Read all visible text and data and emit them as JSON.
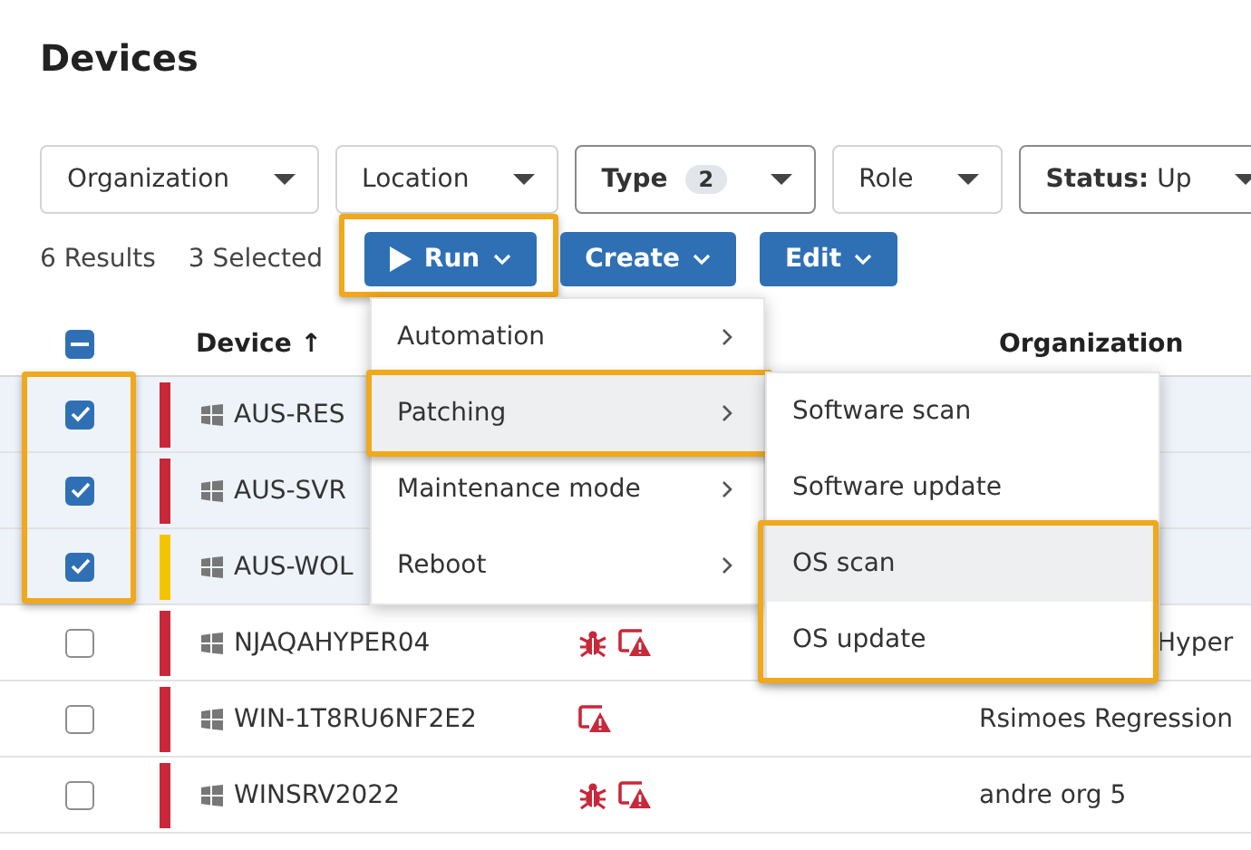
{
  "page": {
    "title": "Devices"
  },
  "filters": [
    {
      "label": "Organization",
      "active": false
    },
    {
      "label": "Location",
      "active": false
    },
    {
      "label": "Type",
      "badge": "2",
      "active": true
    },
    {
      "label": "Role",
      "active": false
    },
    {
      "label": "**Status:** Up",
      "active": true
    }
  ],
  "toolbar": {
    "results": "6 Results",
    "selected": "3 Selected",
    "actions": [
      {
        "label": "Run",
        "kind": "play",
        "highlighted": true
      },
      {
        "label": "Create",
        "kind": "plain",
        "highlighted": false
      },
      {
        "label": "Edit",
        "kind": "plain",
        "highlighted": false
      }
    ]
  },
  "table": {
    "select_all_partial": true,
    "checkbox_highlight": true,
    "columns": [
      {
        "label": "Device",
        "sort": "↑"
      },
      {
        "label": "Organization"
      }
    ],
    "rows": [
      {
        "selected": true,
        "color": "#c8283a",
        "device": "AUS-RES",
        "bug": false,
        "warning": false
      },
      {
        "selected": true,
        "color": "#c8283a",
        "device": "AUS-SVR",
        "bug": false,
        "warning": false
      },
      {
        "selected": true,
        "color": "#f5c400",
        "device": "AUS-WOL",
        "bug": false,
        "warning": false
      },
      {
        "selected": false,
        "color": "#c8283a",
        "device": "NJAQAHYPER04",
        "bug": true,
        "warning": true,
        "organization": "Hyper",
        "organization_clipped_left": true
      },
      {
        "selected": false,
        "color": "#c8283a",
        "device": "WIN-1T8RU6NF2E2",
        "bug": false,
        "warning": true,
        "organization": "Rsimoes Regression"
      },
      {
        "selected": false,
        "color": "#c8283a",
        "device": "WINSRV2022",
        "bug": true,
        "warning": true,
        "organization": "andre org 5"
      }
    ]
  },
  "menu": {
    "items": [
      {
        "label": "Automation",
        "selected": false,
        "highlighted": false
      },
      {
        "label": "Patching",
        "selected": true,
        "highlighted": true
      },
      {
        "label": "Maintenance mode",
        "selected": false,
        "highlighted": false
      },
      {
        "label": "Reboot",
        "selected": false,
        "highlighted": false
      }
    ]
  },
  "submenu": {
    "items": [
      {
        "label": "Software scan",
        "selected": false,
        "highlighted": false
      },
      {
        "label": "Software update",
        "selected": false,
        "highlighted": false
      },
      {
        "label": "OS scan",
        "selected": true,
        "highlighted": true
      },
      {
        "label": "OS update",
        "selected": false,
        "highlighted": true
      }
    ]
  }
}
